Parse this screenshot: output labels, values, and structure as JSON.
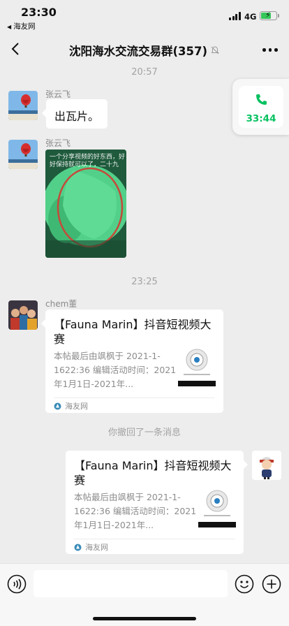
{
  "status_bar": {
    "time": "23:30",
    "back_app": "海友网",
    "network": "4G"
  },
  "nav": {
    "title": "沈阳海水交流交易群(357)"
  },
  "messages": {
    "timestamp_1": "20:57",
    "msg1": {
      "sender": "张云飞",
      "text": "出瓦片。"
    },
    "msg2": {
      "sender": "张云飞",
      "photo_caption": "一个分享视频的好东西，好好保持就可以了，二十九"
    },
    "timestamp_2": "23:25",
    "msg3": {
      "sender": "chem董",
      "card_title": "【Fauna Marin】抖音短视频大赛",
      "card_desc": "本帖最后由飒枫于 2021-1-1622:36 编辑活动时间：2021年1月1日-2021年...",
      "card_source": "海友网"
    },
    "recall_notice": "你撤回了一条消息",
    "msg4": {
      "card_title": "【Fauna Marin】抖音短视频大赛",
      "card_desc": "本帖最后由飒枫于 2021-1-1622:36 编辑活动时间：2021年1月1日-2021年...",
      "card_source": "海友网"
    }
  },
  "call": {
    "duration": "33:44"
  },
  "colors": {
    "accent_green": "#07c160",
    "chat_bg": "#ededed",
    "bubble": "#ffffff"
  }
}
